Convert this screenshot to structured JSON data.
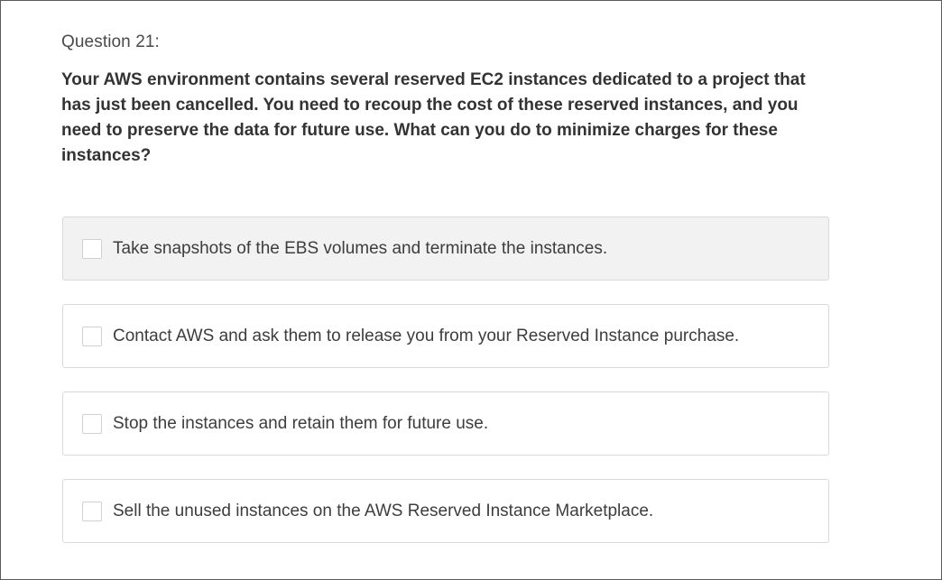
{
  "question": {
    "label": "Question 21:",
    "text": "Your AWS environment contains several reserved EC2 instances dedicated to a project that has just been cancelled. You need to recoup the cost of these reserved instances, and you need to preserve the data for future use. What can you do to minimize charges for these instances?"
  },
  "options": [
    {
      "label": "Take snapshots of the EBS volumes and terminate the instances.",
      "checked": false
    },
    {
      "label": "Contact AWS and ask them to release you from your Reserved Instance purchase.",
      "checked": false
    },
    {
      "label": "Stop the instances and retain them for future use.",
      "checked": false
    },
    {
      "label": "Sell the unused instances on the AWS Reserved Instance Marketplace.",
      "checked": false
    }
  ]
}
